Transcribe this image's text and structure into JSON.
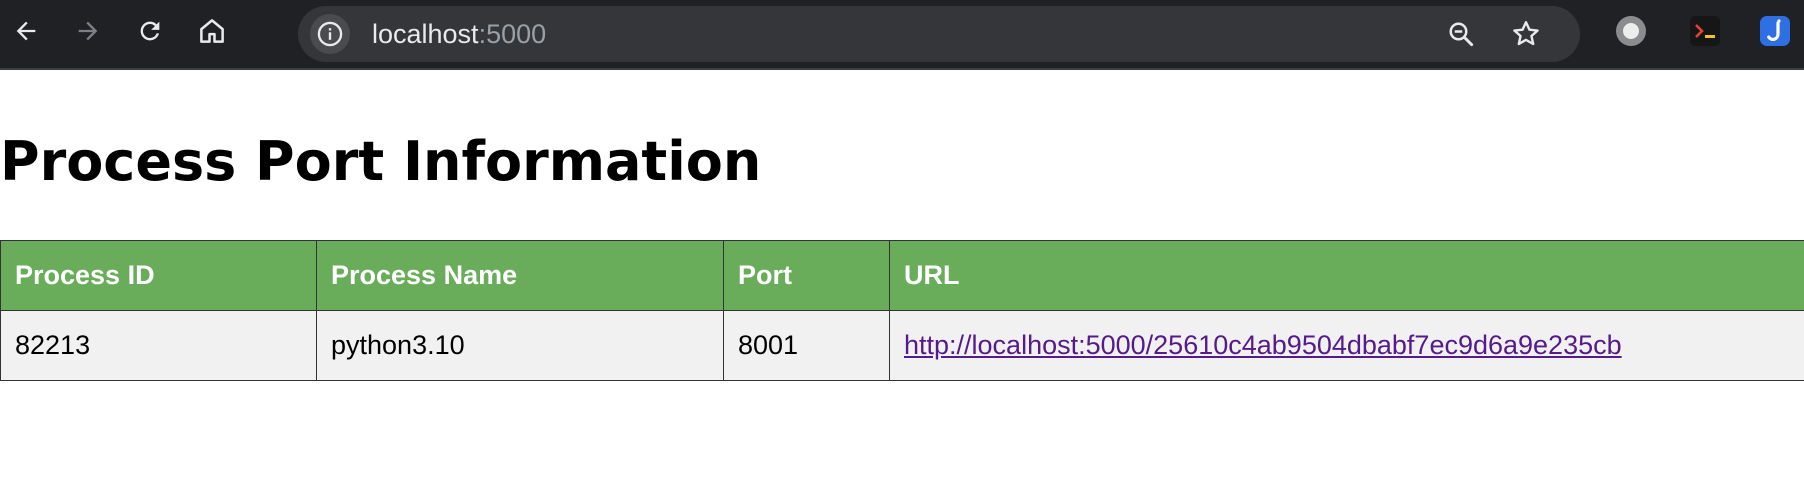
{
  "browser": {
    "url_host": "localhost",
    "url_port": ":5000",
    "icons": {
      "back": "arrow-left-icon",
      "forward": "arrow-right-icon",
      "reload": "reload-icon",
      "home": "home-icon",
      "site_info": "info-icon",
      "zoom": "zoom-out-icon",
      "bookmark": "star-icon",
      "extensions": [
        "circle-extension-icon",
        "terminal-extension-icon",
        "j-extension-icon"
      ]
    },
    "colors": {
      "toolbar_bg": "#202124",
      "omnibox_bg": "#35363a",
      "forward_disabled": "#7d7f84"
    }
  },
  "page": {
    "title": "Process Port Information",
    "table": {
      "headers": [
        "Process ID",
        "Process Name",
        "Port",
        "URL"
      ],
      "rows": [
        {
          "pid": "82213",
          "name": "python3.10",
          "port": "8001",
          "url": "http://localhost:5000/25610c4ab9504dbabf7ec9d6a9e235cb"
        }
      ]
    },
    "colors": {
      "header_bg": "#69ad5b",
      "header_text": "#ffffff",
      "row_bg": "#f1f1f1",
      "link": "#551a8b"
    }
  }
}
